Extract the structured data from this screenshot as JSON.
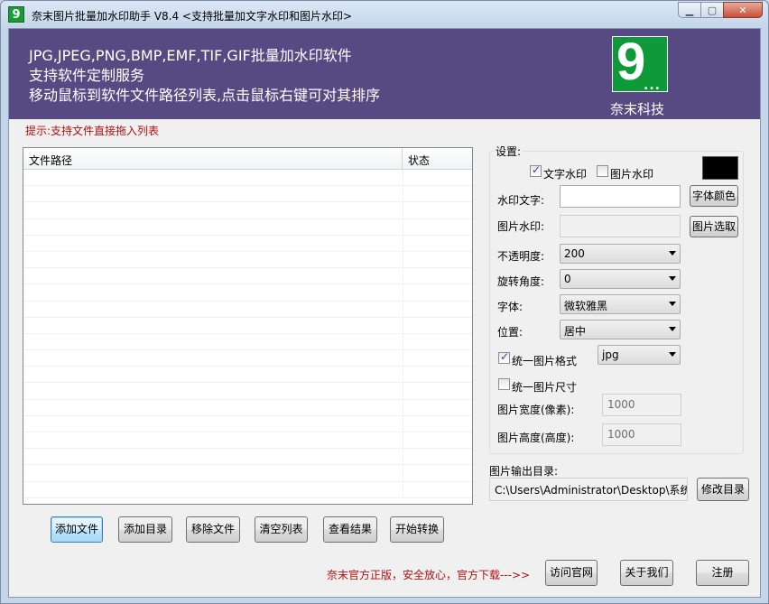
{
  "window": {
    "title": "奈末图片批量加水印助手 V8.4  <支持批量加文字水印和图片水印>",
    "icon_label": "9"
  },
  "banner": {
    "line1": "JPG,JPEG,PNG,BMP,EMF,TIF,GIF批量加水印软件",
    "line2": "支持软件定制服务",
    "line3": "移动鼠标到软件文件路径列表,点击鼠标右键可对其排序",
    "logo_number": "9",
    "logo_dots": "...",
    "logo_text": "奈末科技",
    "bg_color": "#574a82",
    "logo_color": "#0e9a39"
  },
  "tip": "提示:支持文件直接拖入列表",
  "file_list": {
    "columns": [
      "文件路径",
      "状态"
    ]
  },
  "settings": {
    "legend": "设置:",
    "text_watermark_check": "文字水印",
    "text_watermark_checked": true,
    "image_watermark_check": "图片水印",
    "image_watermark_checked": false,
    "watermark_text_label": "水印文字:",
    "watermark_text_value": "",
    "font_color_button": "字体颜色",
    "font_color": "#000000",
    "image_watermark_label": "图片水印:",
    "image_watermark_value": "",
    "image_select_button": "图片选取",
    "opacity_label": "不透明度:",
    "opacity_value": "200",
    "rotation_label": "旋转角度:",
    "rotation_value": "0",
    "font_label": "字体:",
    "font_value": "微软雅黑",
    "position_label": "位置:",
    "position_value": "居中",
    "unify_format_label": "统一图片格式",
    "unify_format_checked": true,
    "format_value": "jpg",
    "unify_size_label": "统一图片尺寸",
    "unify_size_checked": false,
    "width_label": "图片宽度(像素):",
    "width_value": "1000",
    "height_label": "图片高度(高度):",
    "height_value": "1000"
  },
  "output": {
    "label": "图片输出目录:",
    "path": "C:\\Users\\Administrator\\Desktop\\系统之",
    "change_button": "修改目录"
  },
  "actions": {
    "add_file": "添加文件",
    "add_dir": "添加目录",
    "remove_file": "移除文件",
    "clear_list": "清空列表",
    "view_result": "查看结果",
    "start_convert": "开始转换"
  },
  "footer": {
    "notice": "奈末官方正版，安全放心，官方下载--->>",
    "visit_site": "访问官网",
    "about_us": "关于我们",
    "register": "注册"
  }
}
